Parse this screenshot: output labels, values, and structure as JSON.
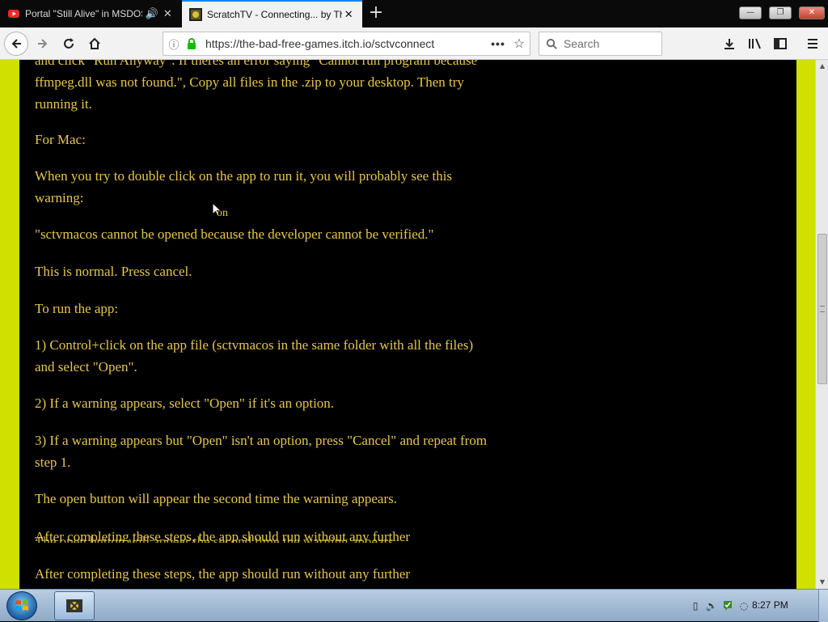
{
  "browser": {
    "tabs": [
      {
        "title": "Portal \"Still Alive\" in MSDOS",
        "favicon": "youtube-icon",
        "active": false
      },
      {
        "title": "ScratchTV - Connecting... by Th",
        "favicon": "scratchtv-icon",
        "active": true
      }
    ],
    "url": "https://the-bad-free-games.itch.io/sctvconnect",
    "search_placeholder": "Search"
  },
  "article": {
    "paragraphs": [
      "and click \"Run Anyway\". If theres an error saying \"Cannot run program because ffmpeg.dll was not found.\", Copy all files in the .zip to your desktop. Then try running it.",
      "For Mac:",
      "When you try to double click on the app to run it, you will probably see this warning:",
      "\"sctvmacos cannot be opened because the developer cannot be verified.\"",
      "This is normal. Press cancel.",
      "To run the app:",
      "1) Control+click on the app file (sctvmacos in the same folder with all the files) and select \"Open\".",
      "2) If a warning appears, select \"Open\" if it's an option.",
      "3) If a warning appears but \"Open\" isn't an option, press \"Cancel\" and repeat from step 1.",
      "The open button will appear the second time the warning appears.",
      "After completing these steps, the app should run without any further"
    ],
    "cursor_text": "on",
    "ghost_line_1": "After completing these steps, the app should run without any further",
    "ghost_line_2": "The open button will appear the second time the warning appears."
  },
  "taskbar": {
    "clock": "8:27 PM",
    "start_icon": "windows-logo-icon",
    "pinned_app_icon": "scratchtv-icon"
  },
  "colors": {
    "text": "#e6c64c",
    "sidebar": "#d0e000",
    "page_bg": "#000000",
    "tab_accent": "#0a84ff"
  }
}
